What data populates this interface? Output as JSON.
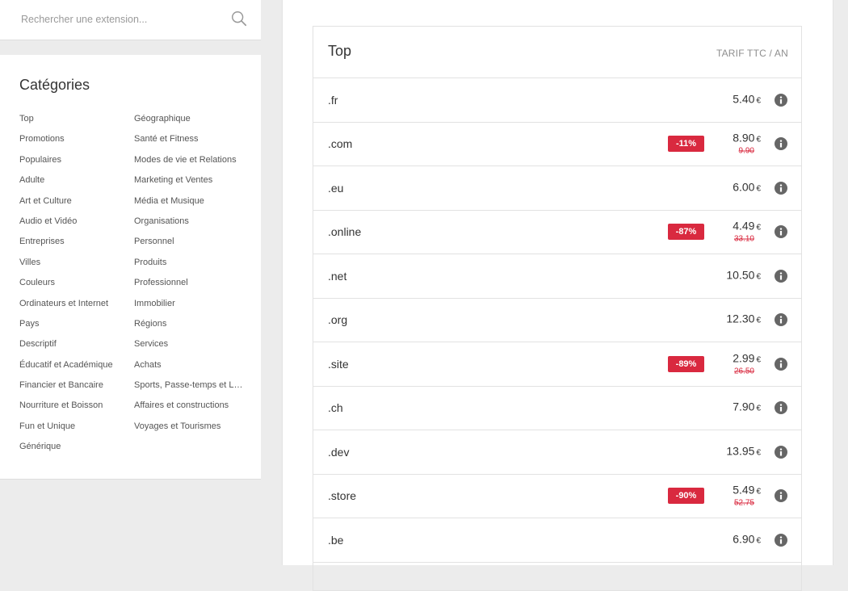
{
  "search": {
    "placeholder": "Rechercher une extension..."
  },
  "categories": {
    "title": "Catégories",
    "col1": [
      "Top",
      "Promotions",
      "Populaires",
      "Adulte",
      "Art et Culture",
      "Audio et Vidéo",
      "Entreprises",
      "Villes",
      "Couleurs",
      "Ordinateurs et Internet",
      "Pays",
      "Descriptif",
      "Éducatif et Académique",
      "Financier et Bancaire",
      "Nourriture et Boisson",
      "Fun et Unique",
      "Générique"
    ],
    "col2": [
      "Géographique",
      "Santé et Fitness",
      "Modes de vie et Relations",
      "Marketing et Ventes",
      "Média et Musique",
      "Organisations",
      "Personnel",
      "Produits",
      "Professionnel",
      "Immobilier",
      "Régions",
      "Services",
      "Achats",
      "Sports, Passe-temps et Loisirs",
      "Affaires et constructions",
      "Voyages et Tourismes"
    ]
  },
  "table": {
    "title": "Top",
    "subtitle": "TARIF TTC / AN",
    "currency": "€",
    "rows": [
      {
        "ext": ".fr",
        "price": "5.40",
        "discount": "",
        "old_price": ""
      },
      {
        "ext": ".com",
        "price": "8.90",
        "discount": "-11%",
        "old_price": "9.90"
      },
      {
        "ext": ".eu",
        "price": "6.00",
        "discount": "",
        "old_price": ""
      },
      {
        "ext": ".online",
        "price": "4.49",
        "discount": "-87%",
        "old_price": "33.10"
      },
      {
        "ext": ".net",
        "price": "10.50",
        "discount": "",
        "old_price": ""
      },
      {
        "ext": ".org",
        "price": "12.30",
        "discount": "",
        "old_price": ""
      },
      {
        "ext": ".site",
        "price": "2.99",
        "discount": "-89%",
        "old_price": "26.50"
      },
      {
        "ext": ".ch",
        "price": "7.90",
        "discount": "",
        "old_price": ""
      },
      {
        "ext": ".dev",
        "price": "13.95",
        "discount": "",
        "old_price": ""
      },
      {
        "ext": ".store",
        "price": "5.49",
        "discount": "-90%",
        "old_price": "52.75"
      },
      {
        "ext": ".be",
        "price": "6.90",
        "discount": "",
        "old_price": ""
      }
    ]
  },
  "colors": {
    "accent_red": "#d9293f",
    "info_icon": "#666666",
    "background": "#ececec"
  }
}
